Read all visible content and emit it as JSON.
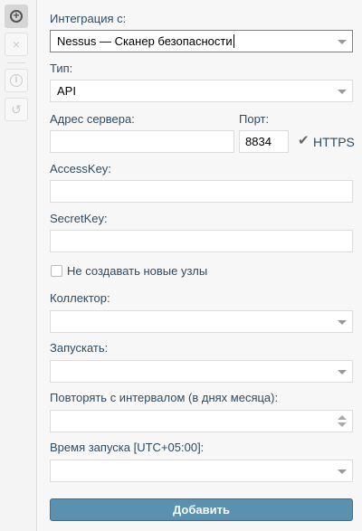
{
  "sidebar": {
    "items": [
      {
        "icon": "plus-circle-icon",
        "active": true
      },
      {
        "icon": "close-icon"
      },
      {
        "icon": "info-icon"
      },
      {
        "icon": "history-icon"
      }
    ]
  },
  "form": {
    "integration_label": "Интеграция с:",
    "integration_value": "Nessus — Сканер безопасности",
    "type_label": "Тип:",
    "type_value": "API",
    "server_label": "Адрес сервера:",
    "server_value": "",
    "port_label": "Порт:",
    "port_value": "8834",
    "https_label": "HTTPS",
    "https_checked": true,
    "accesskey_label": "AccessKey:",
    "accesskey_value": "",
    "secretkey_label": "SecretKey:",
    "secretkey_value": "",
    "nocreate_label": "Не создавать новые узлы",
    "nocreate_checked": false,
    "collector_label": "Коллектор:",
    "collector_value": "",
    "run_label": "Запускать:",
    "run_value": "",
    "repeat_label": "Повторять с интервалом (в днях месяца):",
    "repeat_value": "",
    "time_label": "Время запуска [UTC+05:00]:",
    "time_value": "",
    "submit_label": "Добавить"
  }
}
